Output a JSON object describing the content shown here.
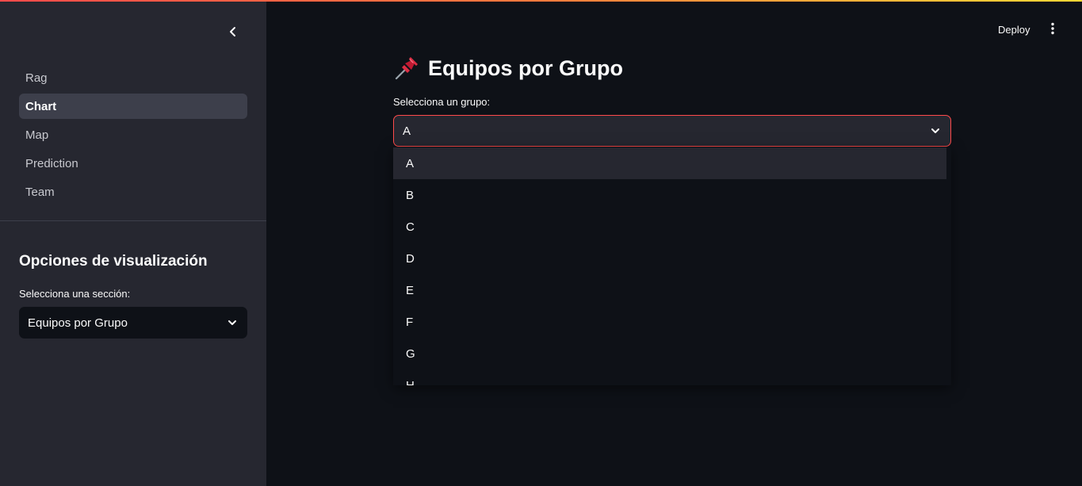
{
  "sidebar": {
    "nav_items": [
      {
        "label": "Rag"
      },
      {
        "label": "Chart"
      },
      {
        "label": "Map"
      },
      {
        "label": "Prediction"
      },
      {
        "label": "Team"
      }
    ],
    "active_nav": "Chart",
    "section_heading": "Opciones de visualización",
    "select_label": "Selecciona una sección:",
    "select_value": "Equipos por Grupo"
  },
  "header": {
    "deploy_label": "Deploy"
  },
  "main": {
    "title": "Equipos por Grupo",
    "title_icon": "pushpin-icon",
    "group_label": "Selecciona un grupo:",
    "group_value": "A",
    "group_options": [
      "A",
      "B",
      "C",
      "D",
      "E",
      "F",
      "G",
      "H"
    ],
    "highlighted_option": "A"
  },
  "colors": {
    "accent": "#ff4b4b",
    "background": "#0e1117",
    "sidebar": "#262730"
  }
}
